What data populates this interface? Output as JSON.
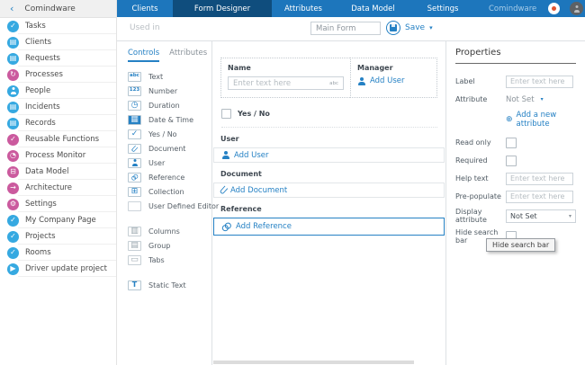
{
  "sidebar": {
    "header": {
      "back_icon": "chevron-left",
      "title": "Comindware"
    },
    "items": [
      {
        "label": "Tasks",
        "icon": "check",
        "color": "blue"
      },
      {
        "label": "Clients",
        "icon": "document",
        "color": "blue"
      },
      {
        "label": "Requests",
        "icon": "document",
        "color": "blue"
      },
      {
        "label": "Processes",
        "icon": "process",
        "color": "pink"
      },
      {
        "label": "People",
        "icon": "person",
        "color": "blue"
      },
      {
        "label": "Incidents",
        "icon": "document",
        "color": "blue"
      },
      {
        "label": "Records",
        "icon": "document",
        "color": "blue"
      },
      {
        "label": "Reusable Functions",
        "icon": "check",
        "color": "pink"
      },
      {
        "label": "Process Monitor",
        "icon": "chart",
        "color": "pink"
      },
      {
        "label": "Data Model",
        "icon": "database",
        "color": "pink"
      },
      {
        "label": "Architecture",
        "icon": "arrow",
        "color": "pink"
      },
      {
        "label": "Settings",
        "icon": "gear",
        "color": "pink"
      },
      {
        "label": "My Company Page",
        "icon": "check",
        "color": "blue"
      },
      {
        "label": "Projects",
        "icon": "check",
        "color": "blue"
      },
      {
        "label": "Rooms",
        "icon": "check",
        "color": "blue"
      },
      {
        "label": "Driver update project",
        "icon": "send",
        "color": "blue"
      }
    ]
  },
  "topbar": {
    "tabs": [
      {
        "label": "Clients",
        "active": false
      },
      {
        "label": "Form Designer",
        "active": true
      },
      {
        "label": "Attributes",
        "active": false
      },
      {
        "label": "Data Model",
        "active": false
      },
      {
        "label": "Settings",
        "active": false
      }
    ],
    "brand": "Comindware",
    "icons": [
      "notification-dot-icon",
      "user-avatar"
    ]
  },
  "subheader": {
    "used_in": "Used in",
    "form_name_value": "Main Form",
    "save_label": "Save",
    "save_icon": "floppy-disk-icon"
  },
  "controls_panel": {
    "tabs": [
      {
        "label": "Controls",
        "active": true
      },
      {
        "label": "Attributes",
        "active": false
      }
    ],
    "items": [
      {
        "label": "Text",
        "icon": "abc"
      },
      {
        "label": "Number",
        "icon": "123"
      },
      {
        "label": "Duration",
        "icon": "clock"
      },
      {
        "label": "Date & Time",
        "icon": "calendar"
      },
      {
        "label": "Yes / No",
        "icon": "check"
      },
      {
        "label": "Document",
        "icon": "paperclip"
      },
      {
        "label": "User",
        "icon": "person"
      },
      {
        "label": "Reference",
        "icon": "link"
      },
      {
        "label": "Collection",
        "icon": "collection"
      },
      {
        "label": "User Defined Editor",
        "icon": "blank"
      },
      {
        "label": "Columns",
        "icon": "columns",
        "group_break": true
      },
      {
        "label": "Group",
        "icon": "group"
      },
      {
        "label": "Tabs",
        "icon": "tabs"
      },
      {
        "label": "Static Text",
        "icon": "T",
        "group_break": true
      }
    ]
  },
  "canvas": {
    "name_cell": {
      "label": "Name",
      "placeholder": "Enter text here",
      "type_hint": "abc"
    },
    "manager_cell": {
      "label": "Manager",
      "link": "Add User",
      "icon": "person-icon"
    },
    "yesno": {
      "label": "Yes / No",
      "checked": false
    },
    "user": {
      "label": "User",
      "link": "Add User",
      "icon": "person-icon"
    },
    "document": {
      "label": "Document",
      "link": "Add Document",
      "icon": "paperclip-icon"
    },
    "reference": {
      "label": "Reference",
      "link": "Add Reference",
      "icon": "link-icon",
      "selected": true
    }
  },
  "properties": {
    "title": "Properties",
    "label_row": {
      "label": "Label",
      "placeholder": "Enter text here"
    },
    "attribute_row": {
      "label": "Attribute",
      "value": "Not Set"
    },
    "add_attribute_link": "Add a new attribute",
    "read_only_row": {
      "label": "Read only",
      "checked": false
    },
    "required_row": {
      "label": "Required",
      "checked": false
    },
    "help_text_row": {
      "label": "Help text",
      "placeholder": "Enter text here"
    },
    "pre_populate_row": {
      "label": "Pre-populate",
      "placeholder": "Enter text here"
    },
    "display_attribute_row": {
      "label": "Display attribute",
      "value": "Not Set"
    },
    "hide_search_bar_row": {
      "label": "Hide search bar",
      "checked": false
    },
    "tooltip": "Hide search bar"
  },
  "colors": {
    "topbar_blue": "#1d76bc",
    "active_tab_blue": "#0f4d7d",
    "accent_blue": "#2581c4",
    "icon_blue": "#36a9e1",
    "icon_pink": "#cb5a9e",
    "notification_orange": "#e0532f"
  }
}
